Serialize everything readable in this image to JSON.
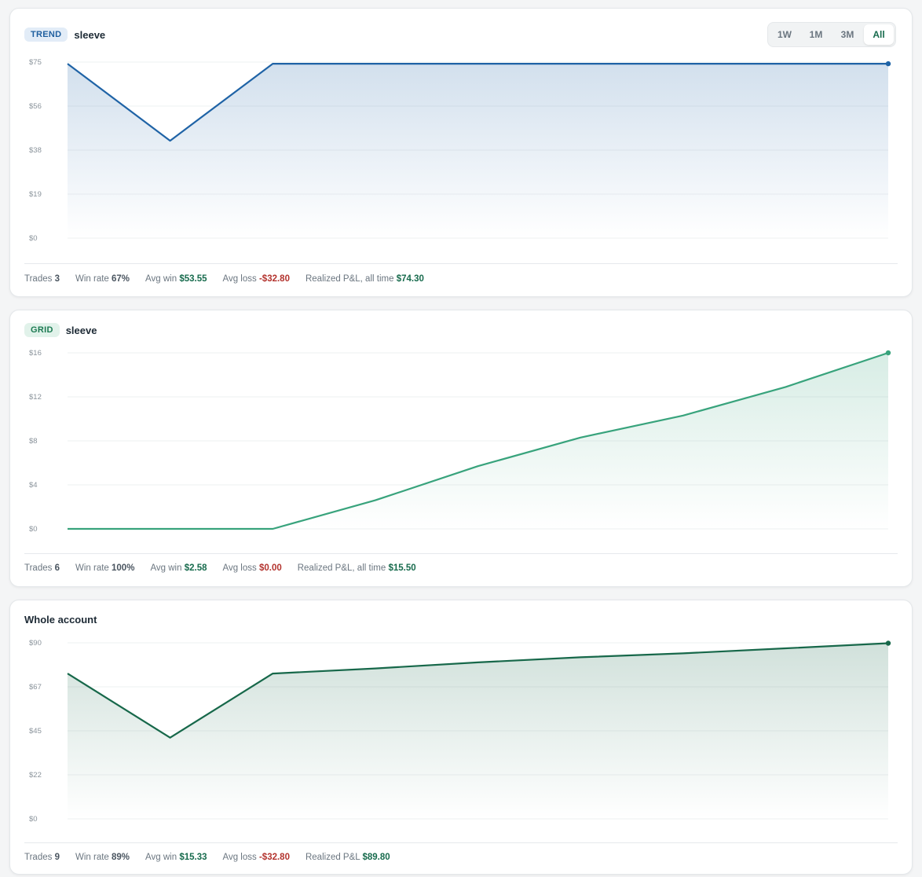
{
  "range_selector": {
    "options": [
      "1W",
      "1M",
      "3M",
      "All"
    ],
    "active": "All"
  },
  "colors": {
    "trend_line": "#1f63a6",
    "grid_line": "#38a37c",
    "whole_line": "#17684a",
    "positive": "#176b4d",
    "negative": "#b3332e"
  },
  "trend": {
    "badge": "TREND",
    "title": "sleeve",
    "stats": {
      "trades_label": "Trades",
      "trades": "3",
      "winrate_label": "Win rate",
      "winrate": "67%",
      "avgwin_label": "Avg win",
      "avgwin": "$53.55",
      "avgloss_label": "Avg loss",
      "avgloss": "-$32.80",
      "pnl_label": "Realized P&L, all time",
      "pnl": "$74.30"
    }
  },
  "grid": {
    "badge": "GRID",
    "title": "sleeve",
    "stats": {
      "trades_label": "Trades",
      "trades": "6",
      "winrate_label": "Win rate",
      "winrate": "100%",
      "avgwin_label": "Avg win",
      "avgwin": "$2.58",
      "avgloss_label": "Avg loss",
      "avgloss": "$0.00",
      "pnl_label": "Realized P&L, all time",
      "pnl": "$15.50"
    }
  },
  "whole": {
    "title": "Whole account",
    "stats": {
      "trades_label": "Trades",
      "trades": "9",
      "winrate_label": "Win rate",
      "winrate": "89%",
      "avgwin_label": "Avg win",
      "avgwin": "$15.33",
      "avgloss_label": "Avg loss",
      "avgloss": "-$32.80",
      "pnl_label": "Realized P&L",
      "pnl": "$89.80"
    }
  },
  "chart_data": [
    {
      "type": "area",
      "id": "trend",
      "x": [
        0,
        1,
        2,
        3,
        4,
        5,
        6,
        7,
        8
      ],
      "values": [
        74.3,
        41.5,
        74.3,
        74.3,
        74.3,
        74.3,
        74.3,
        74.3,
        74.3
      ],
      "yticks": [
        "$0",
        "$19",
        "$38",
        "$56",
        "$75"
      ],
      "ylim": [
        0,
        75
      ],
      "grid": true
    },
    {
      "type": "area",
      "id": "grid",
      "x": [
        0,
        1,
        2,
        3,
        4,
        5,
        6,
        7,
        8
      ],
      "values": [
        0,
        0,
        0,
        2.6,
        5.7,
        8.3,
        10.3,
        12.9,
        16.0
      ],
      "yticks": [
        "$0",
        "$4",
        "$8",
        "$12",
        "$16"
      ],
      "ylim": [
        0,
        16
      ],
      "grid": true
    },
    {
      "type": "area",
      "id": "whole",
      "x": [
        0,
        1,
        2,
        3,
        4,
        5,
        6,
        7,
        8
      ],
      "values": [
        74.3,
        41.5,
        74.3,
        76.9,
        80.0,
        82.6,
        84.6,
        87.2,
        89.8
      ],
      "yticks": [
        "$0",
        "$22",
        "$45",
        "$67",
        "$90"
      ],
      "ylim": [
        0,
        90
      ],
      "grid": true
    }
  ]
}
